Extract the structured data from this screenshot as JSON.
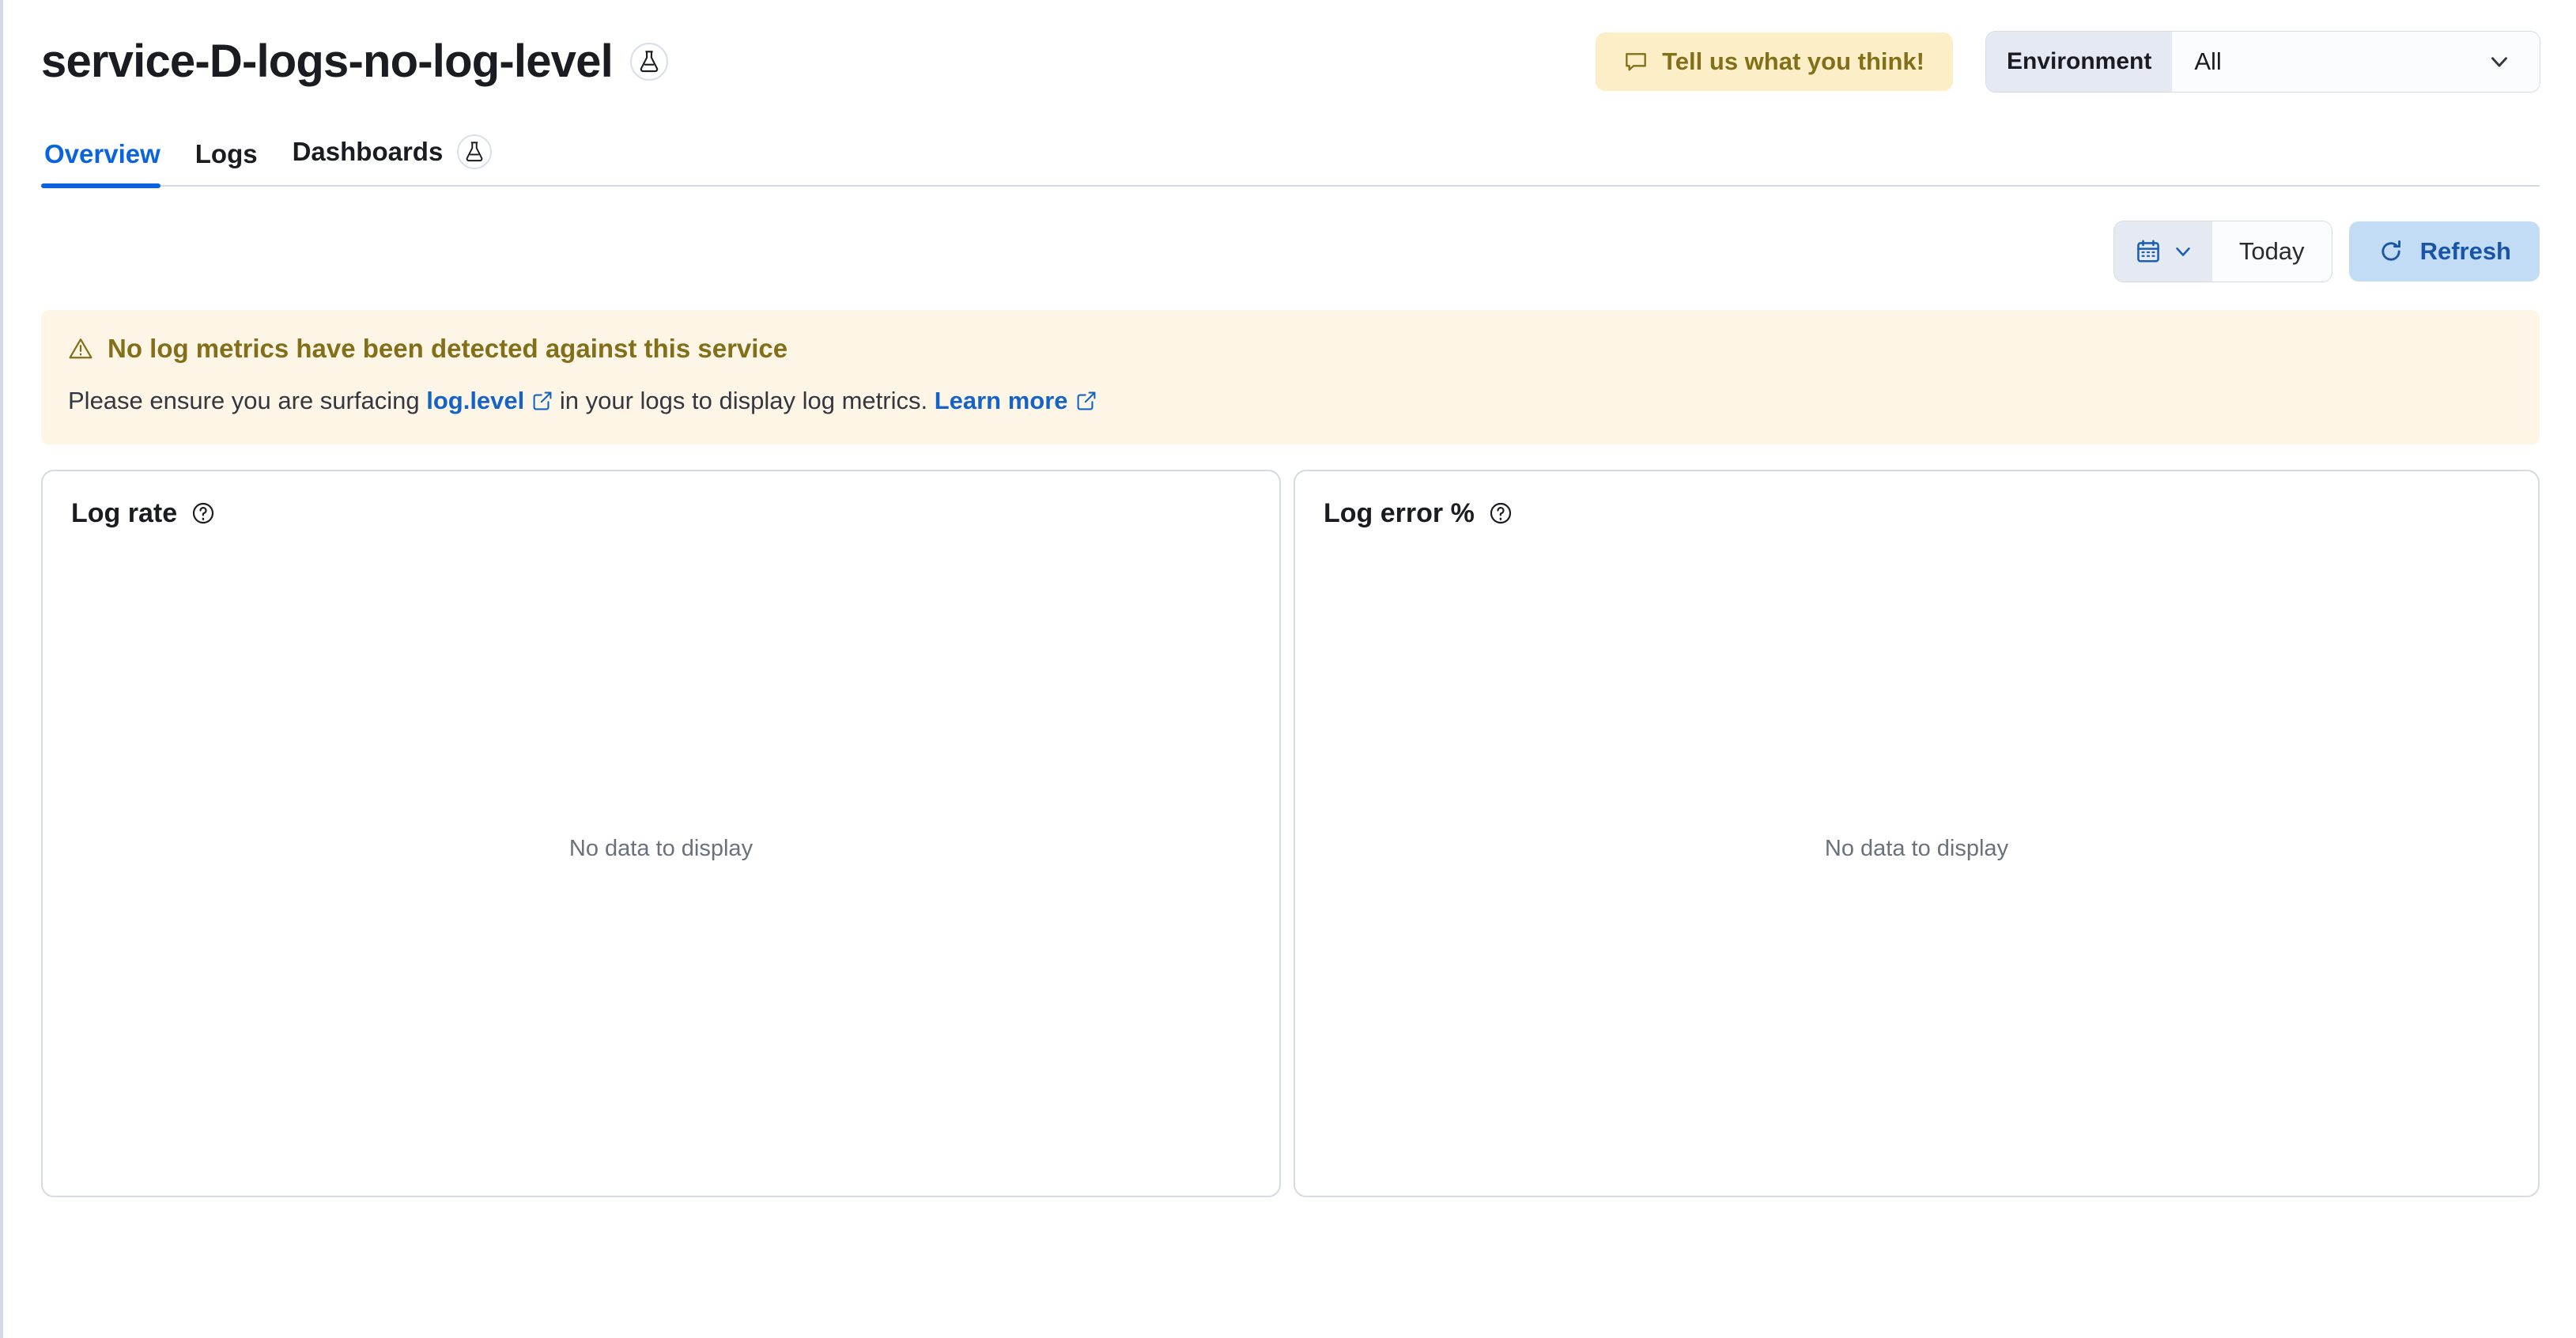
{
  "header": {
    "title": "service-D-logs-no-log-level",
    "beaker_badge_icon": "beaker-icon",
    "feedback": {
      "label": "Tell us what you think!",
      "icon": "comment-icon",
      "bg_color": "#FCEFC7",
      "text_color": "#836F19"
    },
    "environment": {
      "label": "Environment",
      "value": "All",
      "chevron_icon": "chevron-down-icon",
      "options": [
        "All"
      ]
    }
  },
  "tabs": [
    {
      "label": "Overview",
      "active": true,
      "icon": null
    },
    {
      "label": "Logs",
      "active": false,
      "icon": null
    },
    {
      "label": "Dashboards",
      "active": false,
      "icon": "beaker-icon"
    }
  ],
  "toolbar": {
    "calendar_icon": "calendar-icon",
    "calendar_chevron_icon": "chevron-down-icon",
    "date_range": "Today",
    "refresh_label": "Refresh",
    "refresh_icon": "refresh-icon",
    "refresh_bg_color": "#C3DCF5",
    "refresh_text_color": "#1855A8"
  },
  "callout": {
    "icon": "warning-triangle-icon",
    "title": "No log metrics have been detected against this service",
    "body_before": "Please ensure you are surfacing ",
    "link_log_level": "log.level",
    "link_log_level_icon": "external-link-icon",
    "body_middle": " in your logs to display log metrics. ",
    "link_learn_more": "Learn more",
    "link_learn_more_icon": "external-link-icon",
    "bg_color": "#FDF6E7",
    "title_color": "#836F19"
  },
  "panels": [
    {
      "title": "Log rate",
      "help_icon": "question-circle-icon",
      "empty_message": "No data to display"
    },
    {
      "title": "Log error %",
      "help_icon": "question-circle-icon",
      "empty_message": "No data to display"
    }
  ]
}
